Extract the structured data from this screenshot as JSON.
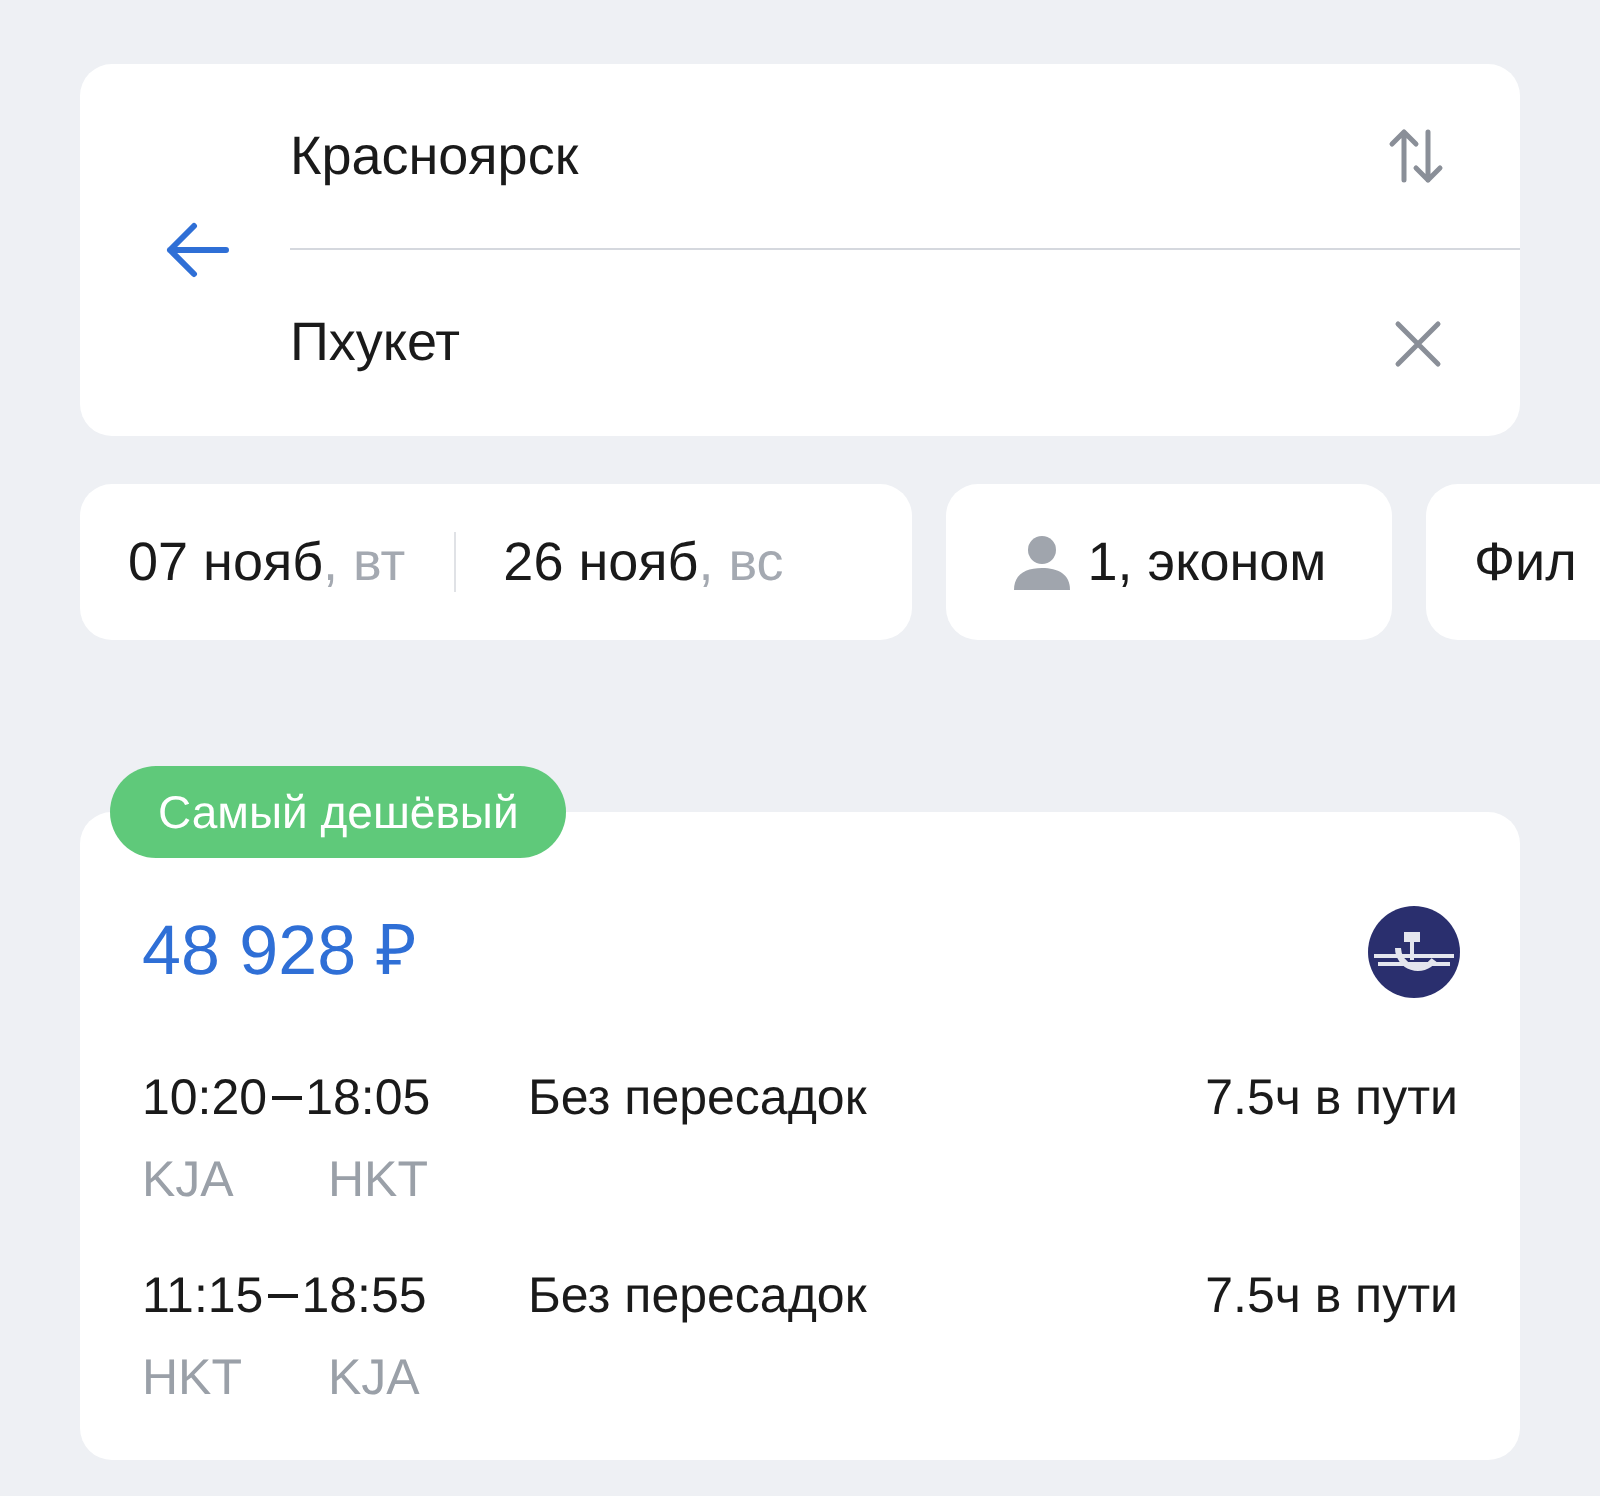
{
  "route": {
    "from": "Красноярск",
    "to": "Пхукет"
  },
  "dates": [
    {
      "date": "07 нояб",
      "weekday": ", вт"
    },
    {
      "date": "26 нояб",
      "weekday": ", вс"
    }
  ],
  "passengers": "1, эконом",
  "filter": "Фил",
  "ticket": {
    "badge": "Самый дешёвый",
    "price": "48 928 ₽",
    "legs": [
      {
        "depart": "10:20",
        "arrive": "18:05",
        "from": "KJA",
        "to": "HKT",
        "stops": "Без пересадок",
        "duration": "7.5ч в пути"
      },
      {
        "depart": "11:15",
        "arrive": "18:55",
        "from": "HKT",
        "to": "KJA",
        "stops": "Без пересадок",
        "duration": "7.5ч в пути"
      }
    ]
  }
}
